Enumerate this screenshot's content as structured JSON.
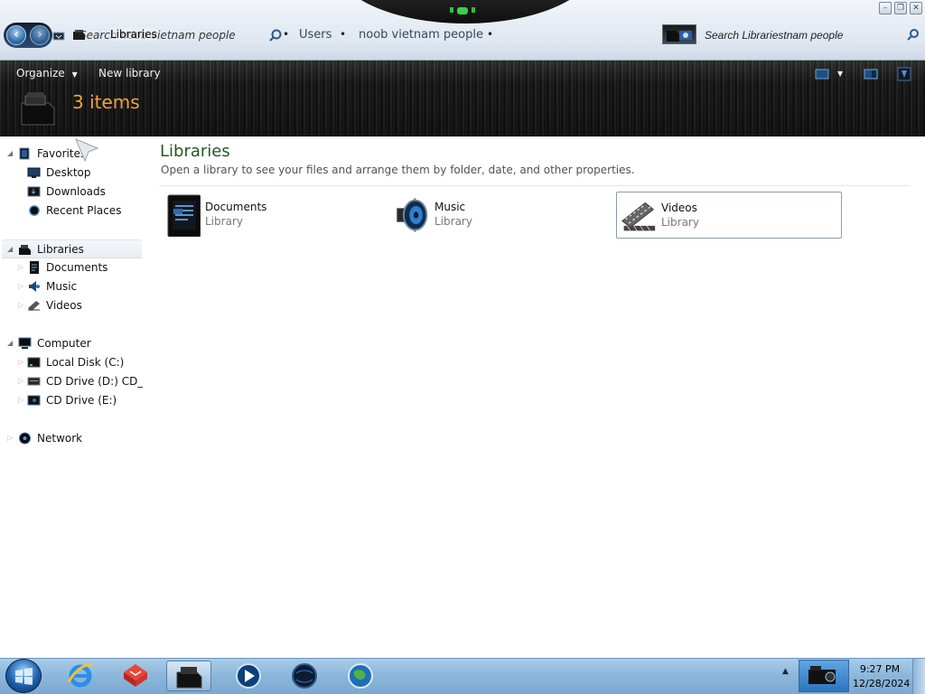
{
  "window": {
    "address_ghost": "Search noob vietnam people",
    "address_current": "Libraries",
    "breadcrumb": [
      "Users",
      "noob vietnam people"
    ],
    "search_placeholder": "Search Librariestnam people",
    "controls": {
      "minimize": "–",
      "maximize": "❐",
      "close": "✕"
    }
  },
  "toolbar": {
    "organize_label": "Organize",
    "new_library_label": "New library",
    "item_count": "3 items"
  },
  "nav": {
    "favorites": {
      "label": "Favorites",
      "items": [
        "Desktop",
        "Downloads",
        "Recent Places"
      ]
    },
    "libraries": {
      "label": "Libraries",
      "items": [
        "Documents",
        "Music",
        "Videos"
      ]
    },
    "computer": {
      "label": "Computer",
      "items": [
        "Local Disk (C:)",
        "CD Drive (D:) CD_RC",
        "CD Drive (E:)"
      ]
    },
    "network": {
      "label": "Network"
    }
  },
  "content": {
    "heading": "Libraries",
    "subtitle": "Open a library to see your files and arrange them by folder, date, and other properties.",
    "libraries": [
      {
        "name": "Documents",
        "type": "Library",
        "icon": "documents-library-icon"
      },
      {
        "name": "Music",
        "type": "Library",
        "icon": "music-library-icon"
      },
      {
        "name": "Videos",
        "type": "Library",
        "icon": "videos-library-icon"
      }
    ]
  },
  "taskbar": {
    "apps": [
      "internet-explorer-icon",
      "red-cube-app-icon",
      "libraries-explorer-icon",
      "media-player-icon",
      "dark-globe-icon",
      "green-globe-icon"
    ],
    "time": "9:27 PM",
    "date": "12/28/2024"
  },
  "colors": {
    "accent_orange": "#f3a13b",
    "heading_green": "#1e5a24",
    "banner_dark": "#1c1c1c",
    "taskbar_blue": "#8db8dc"
  }
}
